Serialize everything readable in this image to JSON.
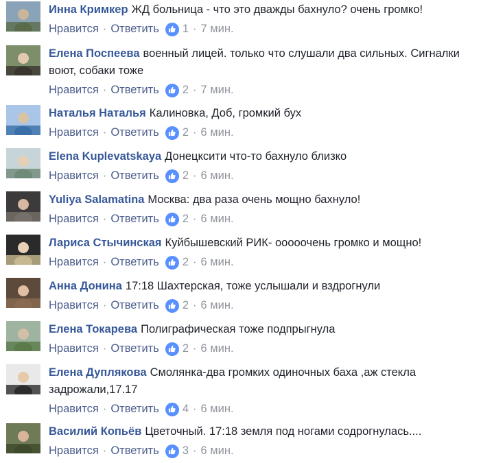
{
  "actions": {
    "like": "Нравится",
    "reply": "Ответить",
    "sep": "·"
  },
  "colors": {
    "author": "#365899",
    "link": "#4b5d8c",
    "meta": "#90949c",
    "like_badge": "#5890ff"
  },
  "comments": [
    {
      "author": "Инна Кримкер",
      "text": "ЖД больница - что это дважды бахнуло? очень громко!",
      "likes": "1",
      "time": "7 мин.",
      "avatar": "avatar-photo-icon"
    },
    {
      "author": "Елена Поспеева",
      "text": "военный лицей. только что слушали два сильных. Сигналки воют, собаки тоже",
      "likes": "2",
      "time": "7 мин.",
      "avatar": "avatar-photo-icon"
    },
    {
      "author": "Наталья Наталья",
      "text": "Калиновка, Доб, громкий бух",
      "likes": "2",
      "time": "6 мин.",
      "avatar": "avatar-photo-icon"
    },
    {
      "author": "Elena Kuplevatskaya",
      "text": "Донецксити что-то бахнуло близко",
      "likes": "2",
      "time": "6 мин.",
      "avatar": "avatar-photo-icon"
    },
    {
      "author": "Yuliya Salamatina",
      "text": "Москва: два раза очень мощно бахнуло!",
      "likes": "2",
      "time": "6 мин.",
      "avatar": "avatar-photo-icon"
    },
    {
      "author": "Лариса Стычинская",
      "text": "Куйбышевский РИК- ооооочень громко и мощно!",
      "likes": "2",
      "time": "6 мин.",
      "avatar": "avatar-photo-icon"
    },
    {
      "author": "Анна Донина",
      "text": "17:18 Шахтерская, тоже услышали и вздрогнули",
      "likes": "2",
      "time": "6 мин.",
      "avatar": "avatar-photo-icon"
    },
    {
      "author": "Елена Токарева",
      "text": "Полиграфическая тоже подпрыгнула",
      "likes": "2",
      "time": "6 мин.",
      "avatar": "avatar-photo-icon"
    },
    {
      "author": "Елена Дуплякова",
      "text": "Смолянка-два громких одиночных баха ,аж стекла задрожали,17.17",
      "likes": "4",
      "time": "6 мин.",
      "avatar": "avatar-photo-icon"
    },
    {
      "author": "Василий Копьёв",
      "text": "Цветочный. 17:18 земля под ногами содрогнулась....",
      "likes": "3",
      "time": "6 мин.",
      "avatar": "avatar-photo-icon"
    }
  ]
}
